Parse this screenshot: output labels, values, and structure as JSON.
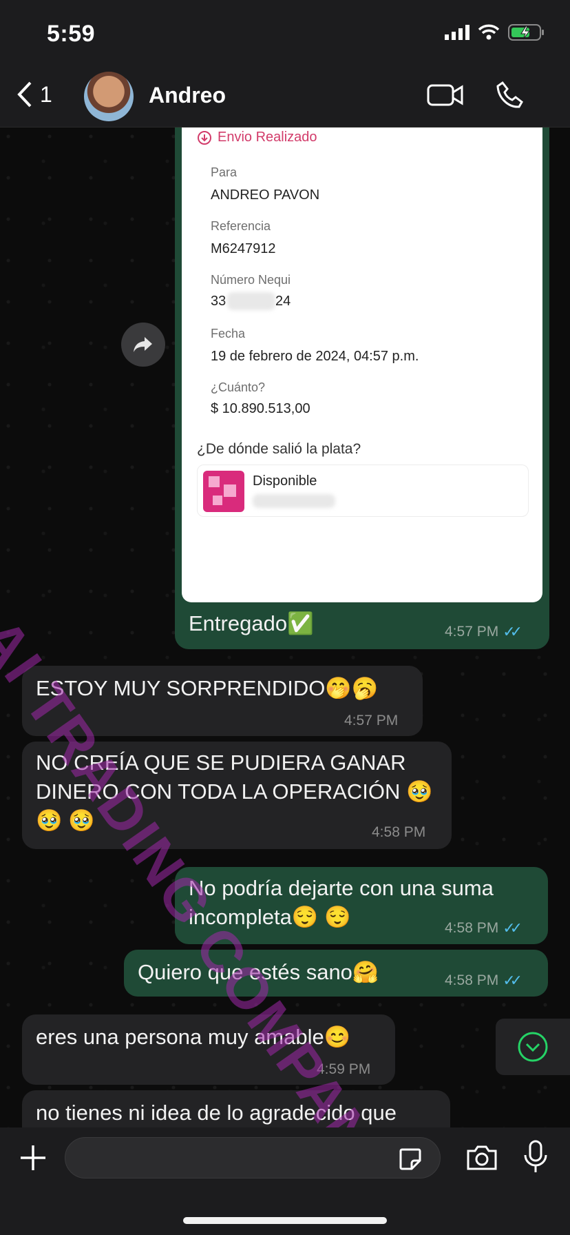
{
  "status_bar": {
    "time": "5:59"
  },
  "header": {
    "back_count": "1",
    "contact_name": "Andreo"
  },
  "receipt": {
    "title": "Envio Realizado",
    "para_label": "Para",
    "para_value": "ANDREO PAVON",
    "ref_label": "Referencia",
    "ref_value": "M6247912",
    "nequi_label": "Número Nequi",
    "nequi_prefix": "33",
    "nequi_suffix": "24",
    "fecha_label": "Fecha",
    "fecha_value": "19 de febrero de 2024, 04:57 p.m.",
    "cuanto_label": "¿Cuánto?",
    "cuanto_value": "$ 10.890.513,00",
    "origen_question": "¿De dónde salió la plata?",
    "origen_value": "Disponible"
  },
  "watermark": "AI TRADING COMPANY",
  "messages": [
    {
      "dir": "out",
      "text": "Entregado✅",
      "time": "4:57 PM"
    },
    {
      "dir": "in",
      "text": "ESTOY MUY SORPRENDIDO🤭🥱",
      "time": "4:57 PM"
    },
    {
      "dir": "in",
      "text": "NO CREÍA QUE SE PUDIERA GANAR DINERO CON TODA LA OPERACIÓN 🥹 🥹 🥹",
      "time": "4:58 PM"
    },
    {
      "dir": "out",
      "text": "No podría dejarte con una suma incompleta😌 😌",
      "time": "4:58 PM"
    },
    {
      "dir": "out",
      "text": "Quiero que estés sano🤗",
      "time": "4:58 PM"
    },
    {
      "dir": "in",
      "text": "eres una persona muy amable😊",
      "time": "4:59 PM"
    },
    {
      "dir": "in",
      "text": "no tienes ni idea de lo agradecido que",
      "time": ""
    }
  ],
  "composer": {
    "placeholder": ""
  }
}
